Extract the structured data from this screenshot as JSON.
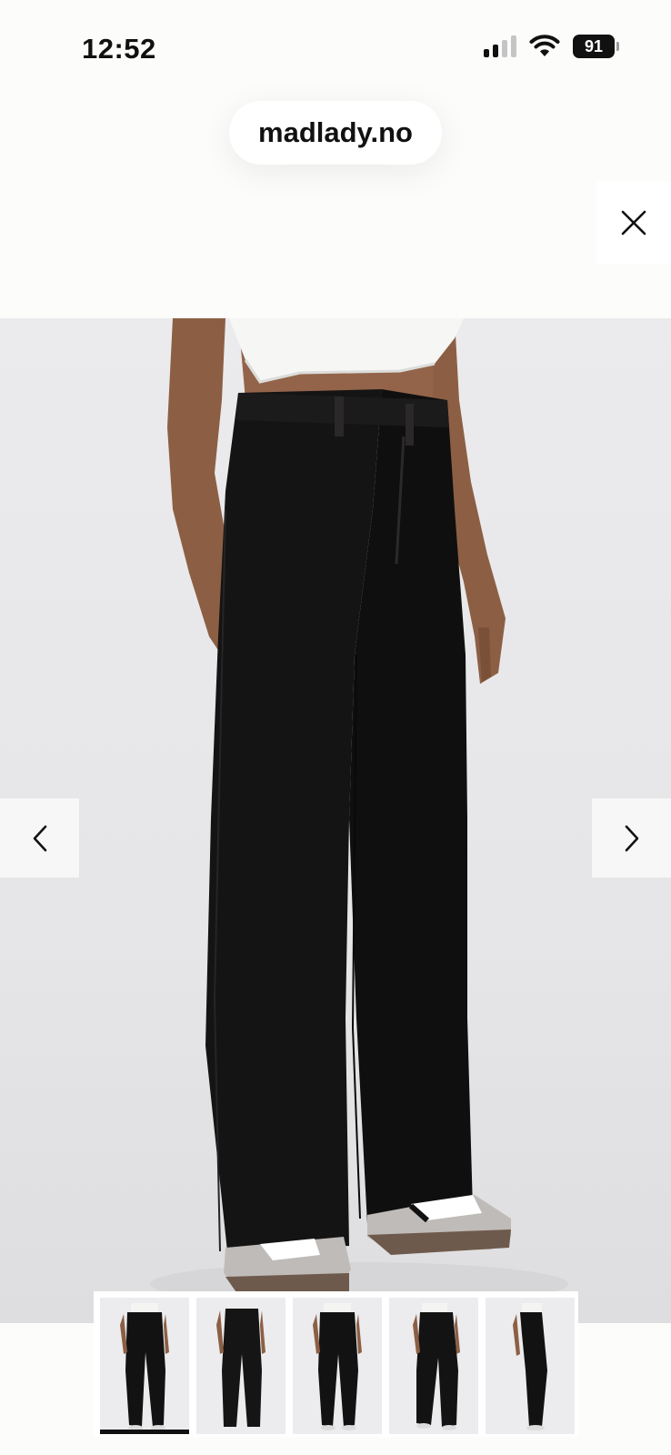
{
  "status_bar": {
    "time": "12:52",
    "battery": "91"
  },
  "browser": {
    "url": "madlady.no"
  },
  "gallery": {
    "product_image": "black straight-leg trousers with white crop top and grey sneakers",
    "background_color": "#e8e8ea",
    "trouser_color": "#141313",
    "thumbnail_count": 5,
    "active_thumbnail": 1
  },
  "icons": {
    "close": "close-icon",
    "prev": "chevron-left-icon",
    "next": "chevron-right-icon",
    "signal": "signal-icon",
    "wifi": "wifi-icon",
    "battery": "battery-icon"
  }
}
